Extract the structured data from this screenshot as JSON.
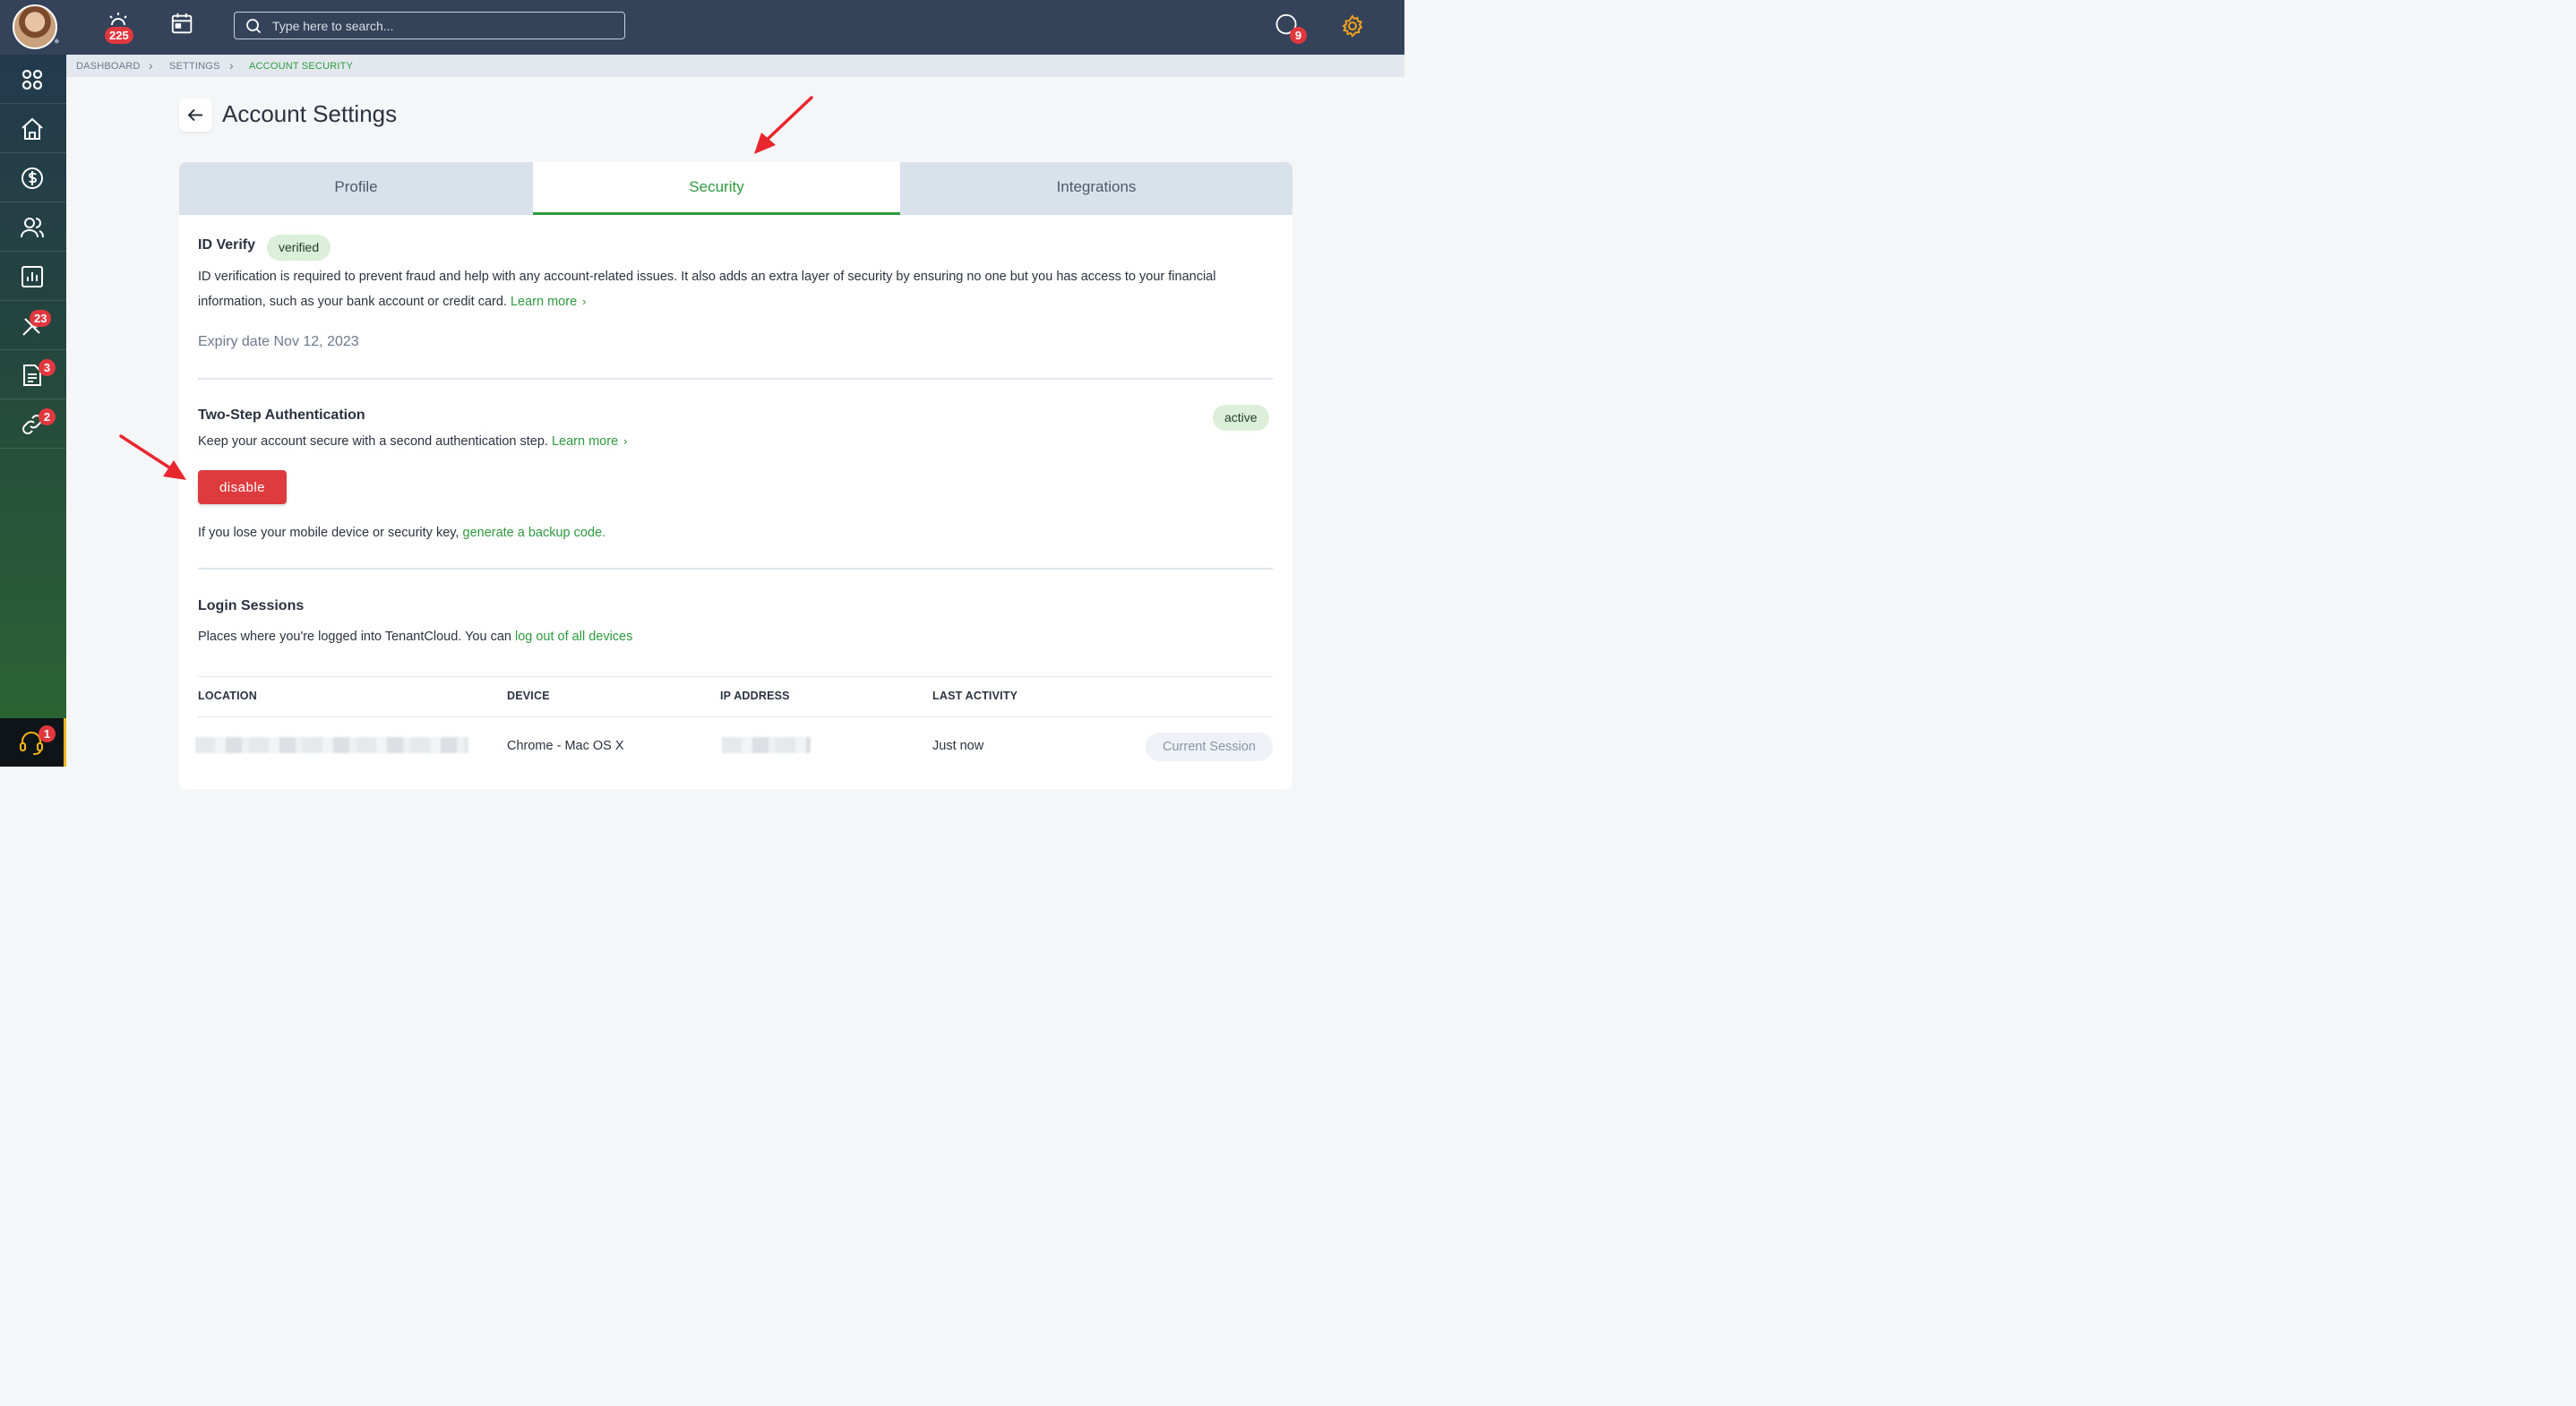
{
  "topbar": {
    "notifications_badge": "225",
    "search_placeholder": "Type here to search...",
    "messages_badge": "9"
  },
  "sidebar": {
    "items": [
      {
        "icon": "apps-grid-icon",
        "badge": ""
      },
      {
        "icon": "home-icon",
        "badge": ""
      },
      {
        "icon": "dollar-circle-icon",
        "badge": ""
      },
      {
        "icon": "users-icon",
        "badge": ""
      },
      {
        "icon": "bar-chart-icon",
        "badge": ""
      },
      {
        "icon": "tools-icon",
        "badge": "23"
      },
      {
        "icon": "document-icon",
        "badge": "3"
      },
      {
        "icon": "link-icon",
        "badge": "2"
      }
    ],
    "support_badge": "1"
  },
  "breadcrumb": [
    "DASHBOARD",
    "SETTINGS",
    "ACCOUNT SECURITY"
  ],
  "page": {
    "title": "Account Settings",
    "tabs": [
      "Profile",
      "Security",
      "Integrations"
    ],
    "active_tab": "Security"
  },
  "id_verify": {
    "title": "ID Verify",
    "badge": "verified",
    "description": "ID verification is required to prevent fraud and help with any account-related issues. It also adds an extra layer of security by ensuring no one but you has access to your financial information, such as your bank account or credit card.",
    "learn_more": "Learn more",
    "expiry": "Expiry date Nov 12, 2023"
  },
  "two_step": {
    "title": "Two-Step Authentication",
    "status": "active",
    "description": "Keep your account secure with a second authentication step.",
    "learn_more": "Learn more",
    "disable_label": "disable",
    "backup_text": "If you lose your mobile device or security key,",
    "backup_link": "generate a backup code."
  },
  "login_sessions": {
    "title": "Login Sessions",
    "description": "Places where you're logged into TenantCloud. You can",
    "logout_link": "log out of all devices",
    "columns": [
      "LOCATION",
      "DEVICE",
      "IP ADDRESS",
      "LAST ACTIVITY"
    ],
    "rows": [
      {
        "device": "Chrome - Mac OS X",
        "last_activity": "Just now",
        "session_label": "Current Session"
      }
    ]
  },
  "colors": {
    "topbar": "#34435a",
    "accent_green": "#2e9a3f",
    "danger_red": "#de3b3f",
    "badge_red": "#e0383e",
    "settings_orange": "#f2a21b"
  }
}
